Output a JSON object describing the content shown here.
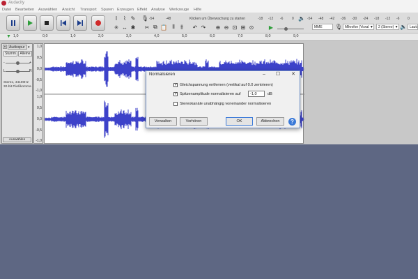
{
  "window": {
    "title": "Audacity"
  },
  "menu": [
    "Datei",
    "Bearbeiten",
    "Auswählen",
    "Ansicht",
    "Transport",
    "Spuren",
    "Erzeugen",
    "Effekt",
    "Analyse",
    "Werkzeuge",
    "Hilfe"
  ],
  "transport": {
    "pause": "pause-icon",
    "play": "play-icon",
    "stop": "stop-icon",
    "skip_start": "skip-start-icon",
    "skip_end": "skip-end-icon",
    "record": "record-icon",
    "play_color": "#2e9e3a",
    "record_color": "#d02a2a"
  },
  "meters": {
    "record_scale": [
      "-54",
      "-48",
      "Klicken um Überwachung zu starten",
      "-18",
      "-12",
      "-6",
      "0"
    ],
    "play_scale": [
      "-54",
      "-48",
      "-42",
      "-36",
      "-30",
      "-24",
      "-18",
      "-12",
      "-6",
      "0"
    ]
  },
  "device_toolbar": {
    "host": "MME",
    "recording_device": "Mikrofon (Voxal ▼",
    "channels": "2 (Stereo) ▼",
    "playback_device": "Lautspre"
  },
  "ruler": {
    "ticks": [
      "1,0",
      "0,0",
      "1,0",
      "2,0",
      "3,0",
      "4,0",
      "5,0",
      "6,0",
      "7,0",
      "8,0",
      "9,0"
    ]
  },
  "track": {
    "name": "Audiospur",
    "mute_label": "Stumm",
    "solo_label": "Alleine",
    "info_line1": "Stereo, 44100Hz",
    "info_line2": "32-bit Fließkomma",
    "select_label": "Auswählen",
    "scale_top": [
      "1,0",
      "0,5",
      "0,0",
      "-0,5",
      "-1,0"
    ],
    "scale_bottom": [
      "1,0",
      "0,5",
      "0,0",
      "-0,5",
      "-1,0"
    ],
    "waveform_color": "#3d42c9"
  },
  "dialog": {
    "title": "Normalisieren",
    "option1_label": "Gleichspannung entfernen (vertikal auf 0.0 zentrieren)",
    "option1_checked": true,
    "option2_label": "Spitzenamplitude normalisieren auf",
    "option2_checked": true,
    "peak_value": "-1,0",
    "peak_unit": "dB",
    "option3_label": "Stereokanäle unabhängig voneinander normalisieren",
    "option3_checked": false,
    "manage_label": "Verwalten",
    "preview_label": "Vorhören",
    "ok_label": "OK",
    "cancel_label": "Abbrechen",
    "help_label": "?"
  }
}
